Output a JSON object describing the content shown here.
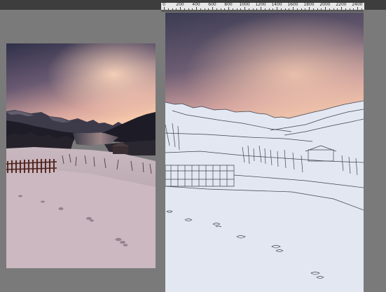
{
  "ruler": {
    "labels": [
      "0",
      "200",
      "400",
      "600",
      "800",
      "1000",
      "1200",
      "1400",
      "1600",
      "1800",
      "2000",
      "2200",
      "2400"
    ]
  },
  "colors": {
    "workspace": "#7a7a7a",
    "topbar": "#3d3d3d",
    "ruler": "#e7e7e7",
    "sky_top": "#3b3c52",
    "sky_glow": "#f0c1a8",
    "snow": "#d5c3c9",
    "sketch_paper": "#e3e7f2",
    "sketch_line": "#3e434e"
  },
  "icons": {
    "reference_photo": "reference-photo-image",
    "sketch_layer": "line-sketch-canvas"
  }
}
